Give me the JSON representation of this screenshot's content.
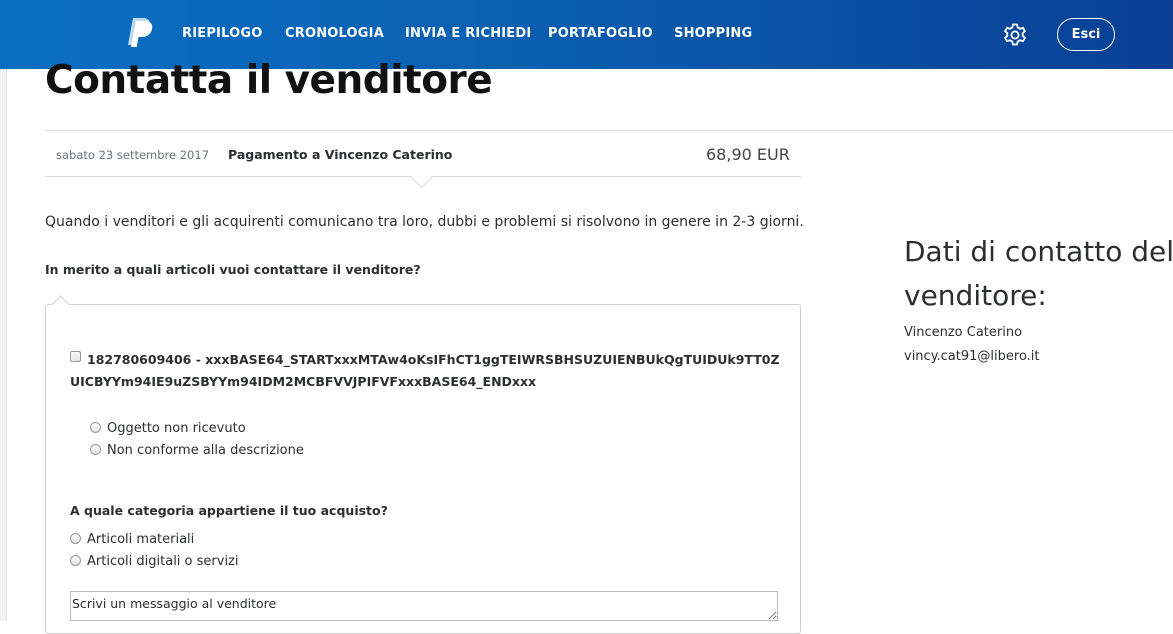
{
  "nav": {
    "logo_icon": "paypal-logo-icon",
    "items": [
      {
        "label": "RIEPILOGO"
      },
      {
        "label": "CRONOLOGIA"
      },
      {
        "label": "INVIA E RICHIEDI"
      },
      {
        "label": "PORTAFOGLIO"
      },
      {
        "label": "SHOPPING"
      }
    ],
    "settings_icon": "gear-icon",
    "logout_label": "Esci"
  },
  "page": {
    "title": "Contatta il venditore"
  },
  "transaction": {
    "date": "sabato 23 settembre 2017",
    "description": "Pagamento a Vincenzo Caterino",
    "amount": "68,90 EUR"
  },
  "intro_text": "Quando i venditori e gli acquirenti comunicano tra loro, dubbi e problemi si risolvono in genere in 2-3 giorni.",
  "form": {
    "items_question": "In merito a quali articoli vuoi contattare il venditore?",
    "item": {
      "checked": false,
      "title": "182780609406 - xxxBASE64_STARTxxxMTAw4oKsIFhCT1ggTEIWRSBHSUZUIENBUkQgTUIDUk9TT0ZUICBYYm94IE9uZSBYYm94IDM2MCBFVVJPIFVFxxxBASE64_ENDxxx",
      "reasons": [
        {
          "label": "Oggetto non ricevuto",
          "selected": false
        },
        {
          "label": "Non conforme alla descrizione",
          "selected": false
        }
      ]
    },
    "category_question": "A quale categoria appartiene il tuo acquisto?",
    "categories": [
      {
        "label": "Articoli materiali",
        "selected": false
      },
      {
        "label": "Articoli digitali o servizi",
        "selected": false
      }
    ],
    "message_placeholder": "Scrivi un messaggio al venditore"
  },
  "seller_contact": {
    "heading": "Dati di contatto del venditore:",
    "name": "Vincenzo Caterino",
    "email": "vincy.cat91@libero.it"
  }
}
